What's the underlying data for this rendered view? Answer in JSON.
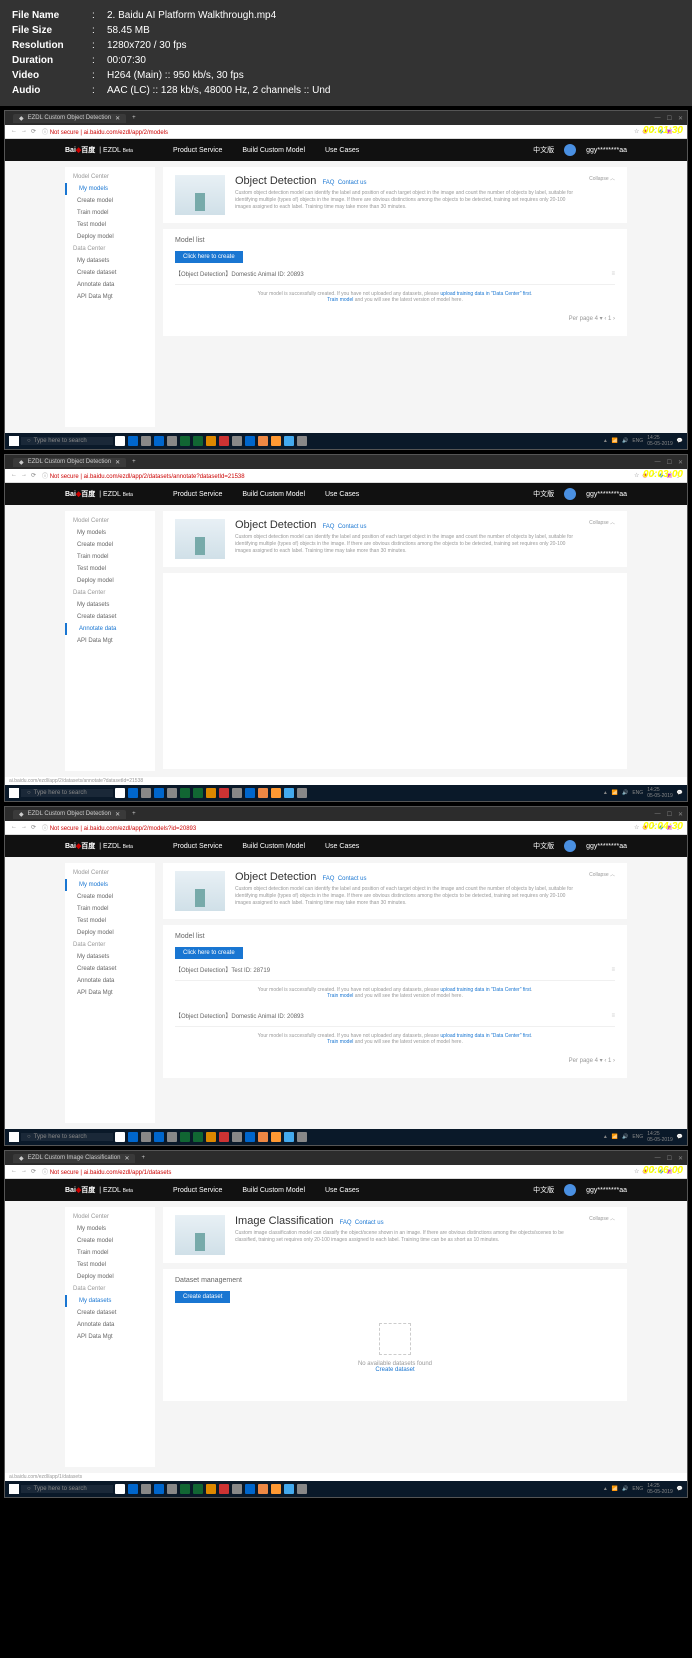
{
  "meta": {
    "filename_label": "File Name",
    "filename": "2. Baidu AI Platform Walkthrough.mp4",
    "filesize_label": "File Size",
    "filesize": "58.45 MB",
    "res_label": "Resolution",
    "res": "1280x720 / 30 fps",
    "dur_label": "Duration",
    "dur": "00:07:30",
    "vid_label": "Video",
    "vid": "H264 (Main) :: 950 kb/s, 30 fps",
    "aud_label": "Audio",
    "aud": "AAC (LC) :: 128 kb/s, 48000 Hz, 2 channels :: Und",
    "sep": ":"
  },
  "frames": [
    {
      "timestamp": "00:01:30",
      "tab": "EZDL Custom Object Detection",
      "url": "Not secure | ai.baidu.com/ezdl/app/2/models",
      "title": "Object Detection",
      "panel_title": "Model list",
      "btn": "Click here to create",
      "desc": "Custom object detection model can identify the label and position of each target object in the image and count the number of objects by label, suitable for identifying multiple (types of) objects in the image. If there are obvious distinctions among the objects to be detected, training set requires only 20-100 images assigned to each label. Training time may take more than 30 minutes.",
      "models": [
        {
          "name": "【Object Detection】Domestic Animal ID: 20893"
        }
      ],
      "msg": "Your model is successfully created. If you have not uploaded any datasets, please ",
      "msg_link": "upload training data in \"Data Center\" first",
      "msg2": "Train model",
      "msg2b": " and you will see the latest version of model here.",
      "active_sidebar": "My models",
      "pager": "Per page  4  ▾   ‹  1  ›",
      "status": "",
      "type": "od_list"
    },
    {
      "timestamp": "00:03:00",
      "tab": "EZDL Custom Object Detection",
      "url": "Not secure | ai.baidu.com/ezdl/app/2/datasets/annotate?datasetId=21538",
      "title": "Object Detection",
      "desc": "Custom object detection model can identify the label and position of each target object in the image and count the number of objects by label, suitable for identifying multiple (types of) objects in the image. If there are obvious distinctions among the objects to be detected, training set requires only 20-100 images assigned to each label. Training time may take more than 30 minutes.",
      "active_sidebar": "Annotate data",
      "status": "ai.baidu.com/ezdl/app/2/datasets/annotate?datasetId=21538",
      "type": "blank"
    },
    {
      "timestamp": "00:04:30",
      "tab": "EZDL Custom Object Detection",
      "url": "Not secure | ai.baidu.com/ezdl/app/2/models?id=20893",
      "title": "Object Detection",
      "panel_title": "Model list",
      "btn": "Click here to create",
      "desc": "Custom object detection model can identify the label and position of each target object in the image and count the number of objects by label, suitable for identifying multiple (types of) objects in the image. If there are obvious distinctions among the objects to be detected, training set requires only 20-100 images assigned to each label. Training time may take more than 30 minutes.",
      "models": [
        {
          "name": "【Object Detection】Test ID: 28719"
        },
        {
          "name": "【Object Detection】Domestic Animal ID: 20893"
        }
      ],
      "msg": "Your model is successfully created. If you have not uploaded any datasets, please ",
      "msg_link": "upload training data in \"Data Center\" first",
      "msg2": "Train model",
      "msg2b": " and you will see the latest version of model here.",
      "active_sidebar": "My models",
      "pager": "Per page  4  ▾   ‹  1  ›",
      "status": "",
      "type": "od_list2"
    },
    {
      "timestamp": "00:06:00",
      "tab": "EZDL Custom Image Classification",
      "url": "Not secure | ai.baidu.com/ezdl/app/1/datasets",
      "title": "Image Classification",
      "panel_title": "Dataset management",
      "btn": "Create dataset",
      "desc": "Custom image classification model can classify the object/scene shown in an image. If there are obvious distinctions among the objects/scenes to be classified, training set requires only 20-100 images assigned to each label. Training time can be as short as 10 minutes.",
      "active_sidebar": "My datasets",
      "empty_text": "No available datasets found",
      "empty_link": "Create dataset",
      "status": "ai.baidu.com/ezdl/app/1/datasets",
      "type": "ic_empty"
    }
  ],
  "nav": {
    "ps": "Product Service",
    "bcm": "Build Custom Model",
    "uc": "Use Cases",
    "lang": "中文版",
    "user": "ggy********aa"
  },
  "sidebar": {
    "mc": "Model Center",
    "mm": "My models",
    "cm": "Create model",
    "tm": "Train model",
    "tem": "Test model",
    "dm": "Deploy model",
    "dc": "Data Center",
    "md": "My datasets",
    "cd": "Create dataset",
    "ad": "Annotate data",
    "api": "API Data Mgt"
  },
  "hero": {
    "faq": "FAQ",
    "contact": "Contact us",
    "collapse": "Collapse  ︿"
  },
  "logo": {
    "baidu": "Bai",
    "du": "百度",
    "ezdl": "EZDL",
    "beta": "Beta"
  },
  "taskbar": {
    "search_ph": "Type here to search",
    "time": "14:25",
    "date": "05-05-2019",
    "lang": "ENG"
  },
  "icons": {
    "menu": "≡",
    "close": "✕",
    "min": "—",
    "max": "☐",
    "back": "←",
    "fwd": "→",
    "reload": "⟳",
    "star": "☆",
    "circle": "○"
  }
}
